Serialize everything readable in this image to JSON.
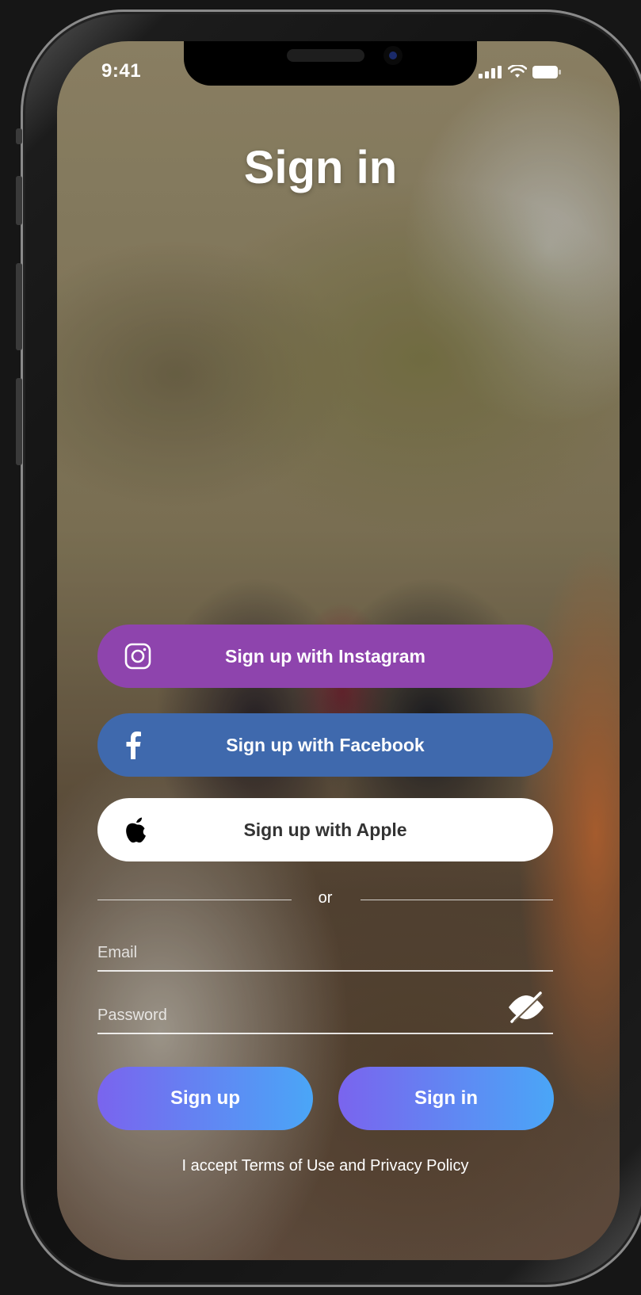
{
  "status_bar": {
    "time": "9:41"
  },
  "screen": {
    "title": "Sign in"
  },
  "social": {
    "instagram_label": "Sign up with Instagram",
    "facebook_label": "Sign up with Facebook",
    "apple_label": "Sign up with Apple"
  },
  "divider": {
    "text": "or"
  },
  "form": {
    "email_placeholder": "Email",
    "password_placeholder": "Password"
  },
  "actions": {
    "signup_label": "Sign up",
    "signin_label": "Sign in"
  },
  "footer": {
    "terms": "I accept Terms of Use and Privacy Policy"
  },
  "colors": {
    "instagram": "#8e44ad",
    "facebook": "#3f69ad",
    "apple": "#ffffff",
    "gradient_start": "#7a64ee",
    "gradient_end": "#4aa6f7"
  },
  "icons": {
    "instagram": "instagram-icon",
    "facebook": "facebook-icon",
    "apple": "apple-icon",
    "password_toggle": "eye-slash-icon",
    "signal": "signal-icon",
    "wifi": "wifi-icon",
    "battery": "battery-icon"
  }
}
